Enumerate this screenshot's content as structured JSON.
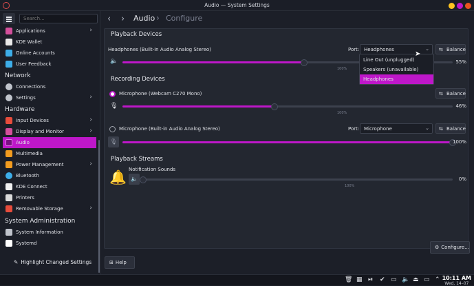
{
  "window": {
    "title": "Audio — System Settings"
  },
  "sidebar": {
    "search_placeholder": "Search...",
    "items": [
      {
        "label": "Applications",
        "has_children": true,
        "icon": "applications-icon",
        "color": "#d34f9b"
      },
      {
        "label": "KDE Wallet",
        "has_children": false,
        "icon": "wallet-icon",
        "color": "#e9e9e9"
      },
      {
        "label": "Online Accounts",
        "has_children": false,
        "icon": "online-accounts-icon",
        "color": "#3daee9"
      },
      {
        "label": "User Feedback",
        "has_children": false,
        "icon": "feedback-icon",
        "color": "#3daee9"
      },
      {
        "label": "Connections",
        "has_children": false,
        "icon": "globe-icon",
        "color": "#c0c4cc"
      },
      {
        "label": "Settings",
        "has_children": true,
        "icon": "network-settings-icon",
        "color": "#c0c4cc"
      },
      {
        "label": "Input Devices",
        "has_children": true,
        "icon": "keyboard-icon",
        "color": "#e74c3c"
      },
      {
        "label": "Display and Monitor",
        "has_children": true,
        "icon": "monitor-icon",
        "color": "#d34f9b"
      },
      {
        "label": "Audio",
        "has_children": false,
        "icon": "audio-icon",
        "color": "#be17c9"
      },
      {
        "label": "Multimedia",
        "has_children": false,
        "icon": "multimedia-icon",
        "color": "#f39c1f"
      },
      {
        "label": "Power Management",
        "has_children": true,
        "icon": "power-icon",
        "color": "#f39c1f"
      },
      {
        "label": "Bluetooth",
        "has_children": false,
        "icon": "bluetooth-icon",
        "color": "#3daee9"
      },
      {
        "label": "KDE Connect",
        "has_children": false,
        "icon": "kde-connect-icon",
        "color": "#f0f0f0"
      },
      {
        "label": "Printers",
        "has_children": false,
        "icon": "printer-icon",
        "color": "#dadada"
      },
      {
        "label": "Removable Storage",
        "has_children": true,
        "icon": "storage-icon",
        "color": "#e74c3c"
      },
      {
        "label": "System Information",
        "has_children": false,
        "icon": "info-icon",
        "color": "#c0c4cc"
      },
      {
        "label": "Systemd",
        "has_children": false,
        "icon": "systemd-icon",
        "color": "#ffffff"
      }
    ],
    "headers": {
      "network": "Network",
      "hardware": "Hardware",
      "system_admin": "System Administration"
    },
    "highlight_button": "Highlight Changed Settings"
  },
  "breadcrumb": {
    "current": "Audio",
    "next": "Configure"
  },
  "playback_devices": {
    "title": "Playback Devices",
    "device": "Headphones (Built-in Audio Analog Stereo)",
    "port_label": "Port:",
    "port_value": "Headphones",
    "balance_label": "Balance",
    "volume_pct": "55%",
    "volume": 0.55,
    "tick_100": "100%"
  },
  "port_dropdown": {
    "options": [
      "Line Out (unplugged)",
      "Speakers (unavailable)",
      "Headphones"
    ],
    "selected": "Headphones"
  },
  "recording_devices": {
    "title": "Recording Devices",
    "devices": [
      {
        "name": "Microphone (Webcam C270 Mono)",
        "selected": true,
        "volume_pct": "46%",
        "volume": 0.46,
        "balance_label": "Balance",
        "tick_100": "100%"
      },
      {
        "name": "Microphone (Built-in Audio Analog Stereo)",
        "selected": false,
        "port_label": "Port:",
        "port_value": "Microphone",
        "volume_pct": "100%",
        "volume": 1.0,
        "balance_label": "Balance"
      }
    ]
  },
  "playback_streams": {
    "title": "Playback Streams",
    "stream": "Notification Sounds",
    "volume_pct": "0%",
    "volume": 0.0,
    "tick_100": "100%"
  },
  "buttons": {
    "configure": "Configure...",
    "help": "Help"
  },
  "taskbar": {
    "time": "10:11 AM",
    "date": "Wed, 14–07"
  },
  "colors": {
    "accent": "#be17c9",
    "close": "#e95420"
  }
}
